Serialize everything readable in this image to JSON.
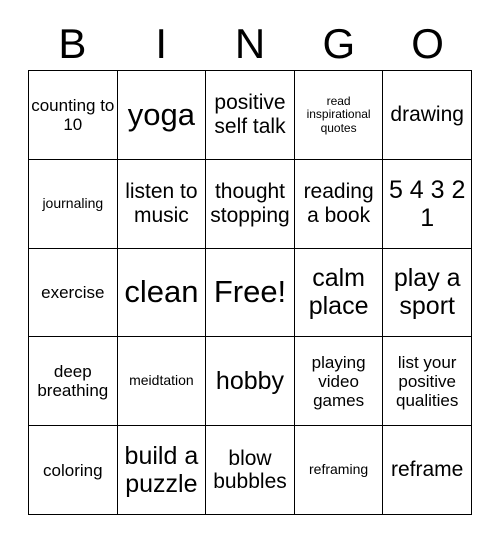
{
  "card": {
    "header_letters": [
      "B",
      "I",
      "N",
      "G",
      "O"
    ],
    "rows": [
      [
        {
          "text": "counting to 10",
          "size": "fs-sm"
        },
        {
          "text": "yoga",
          "size": "fs-xl"
        },
        {
          "text": "positive self talk",
          "size": "fs-md"
        },
        {
          "text": "read inspirational quotes",
          "size": "fs-xxs"
        },
        {
          "text": "drawing",
          "size": "fs-md"
        }
      ],
      [
        {
          "text": "journaling",
          "size": "fs-xs"
        },
        {
          "text": "listen to music",
          "size": "fs-md"
        },
        {
          "text": "thought stopping",
          "size": "fs-md"
        },
        {
          "text": "reading a book",
          "size": "fs-md"
        },
        {
          "text": "5 4 3 2 1",
          "size": "fs-lg"
        }
      ],
      [
        {
          "text": "exercise",
          "size": "fs-sm"
        },
        {
          "text": "clean",
          "size": "fs-xl"
        },
        {
          "text": "Free!",
          "size": "fs-xl"
        },
        {
          "text": "calm place",
          "size": "fs-lg"
        },
        {
          "text": "play a sport",
          "size": "fs-lg"
        }
      ],
      [
        {
          "text": "deep breathing",
          "size": "fs-sm"
        },
        {
          "text": "meidtation",
          "size": "fs-xs"
        },
        {
          "text": "hobby",
          "size": "fs-lg"
        },
        {
          "text": "playing video games",
          "size": "fs-sm"
        },
        {
          "text": "list your positive qualities",
          "size": "fs-sm"
        }
      ],
      [
        {
          "text": "coloring",
          "size": "fs-sm"
        },
        {
          "text": "build a puzzle",
          "size": "fs-lg"
        },
        {
          "text": "blow bubbles",
          "size": "fs-md"
        },
        {
          "text": "reframing",
          "size": "fs-xs"
        },
        {
          "text": "reframe",
          "size": "fs-md"
        }
      ]
    ]
  }
}
